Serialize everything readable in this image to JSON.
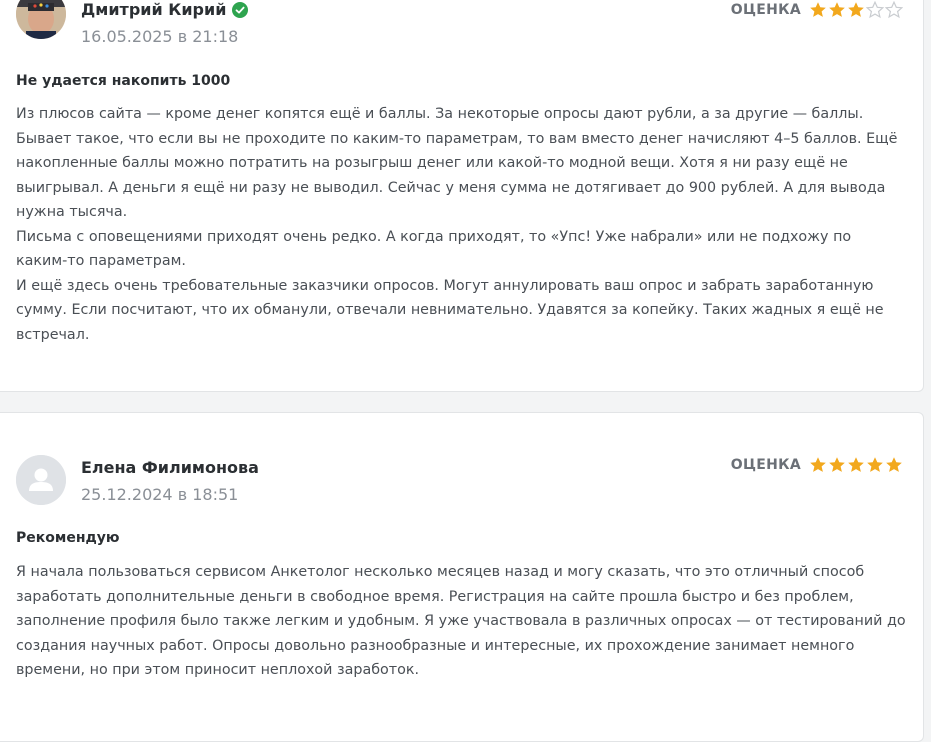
{
  "reviews": [
    {
      "author": "Дмитрий Кирий",
      "verified": true,
      "date": "16.05.2025 в 21:18",
      "rating_label": "ОЦЕНКА",
      "rating": 3,
      "max_rating": 5,
      "title": "Не удается накопить 1000",
      "paragraphs": [
        "Из плюсов сайта — кроме денег копятся ещё и баллы. За некоторые опросы дают рубли, а за другие — баллы. Бывает такое, что если вы не проходите по каким-то параметрам, то вам вместо денег начисляют 4–5 баллов. Ещё накопленные баллы можно потратить на розыгрыш денег или какой-то модной вещи. Хотя я ни разу ещё не выигрывал. А деньги я ещё ни разу не выводил. Сейчас у меня сумма не дотягивает до 900 рублей. А для вывода нужна тысяча.",
        "Письма с оповещениями приходят очень редко. А когда приходят, то «Упс! Уже набрали» или не подхожу по каким-то параметрам.",
        "И ещё здесь очень требовательные заказчики опросов. Могут аннулировать ваш опрос и забрать заработанную сумму. Если посчитают, что их обманули, отвечали невнимательно. Удавятся за копейку. Таких жадных я ещё не встречал."
      ]
    },
    {
      "author": "Елена Филимонова",
      "verified": false,
      "date": "25.12.2024 в 18:51",
      "rating_label": "ОЦЕНКА",
      "rating": 5,
      "max_rating": 5,
      "title": "Рекомендую",
      "paragraphs": [
        "Я начала пользоваться сервисом Анкетолог несколько месяцев назад и могу сказать, что это отличный способ заработать дополнительные деньги в свободное время. Регистрация на сайте прошла быстро и без проблем, заполнение профиля было также легким и удобным. Я уже участвовала в различных опросах — от тестирований до создания научных работ. Опросы довольно разнообразные и интересные, их прохождение занимает немного времени, но при этом приносит неплохой заработок."
      ]
    }
  ],
  "colors": {
    "star_filled": "#f2a81d",
    "star_empty": "#c9ccd0",
    "verified": "#2ea44f"
  }
}
